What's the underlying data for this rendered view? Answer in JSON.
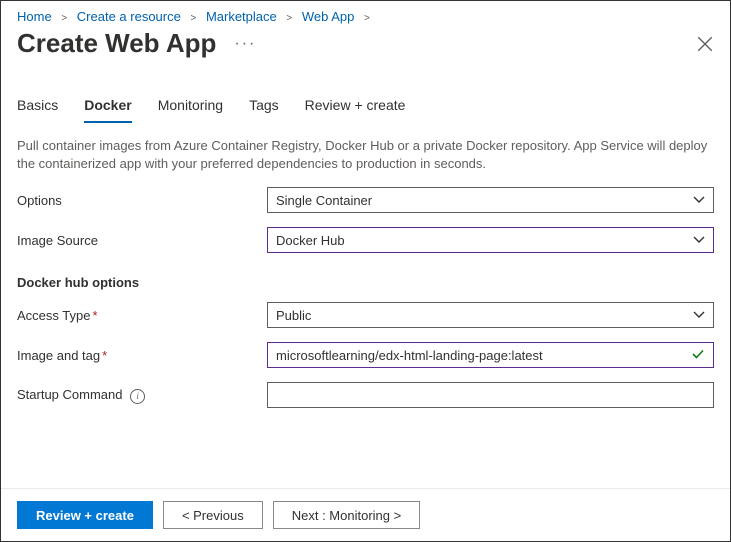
{
  "breadcrumbs": [
    {
      "label": "Home"
    },
    {
      "label": "Create a resource"
    },
    {
      "label": "Marketplace"
    },
    {
      "label": "Web App"
    }
  ],
  "title": "Create Web App",
  "tabs": [
    {
      "label": "Basics",
      "active": false
    },
    {
      "label": "Docker",
      "active": true
    },
    {
      "label": "Monitoring",
      "active": false
    },
    {
      "label": "Tags",
      "active": false
    },
    {
      "label": "Review + create",
      "active": false
    }
  ],
  "description": "Pull container images from Azure Container Registry, Docker Hub or a private Docker repository. App Service will deploy the containerized app with your preferred dependencies to production in seconds.",
  "labels": {
    "options": "Options",
    "image_source": "Image Source",
    "docker_hub_options": "Docker hub options",
    "access_type": "Access Type",
    "image_and_tag": "Image and tag",
    "startup_command": "Startup Command"
  },
  "values": {
    "options": "Single Container",
    "image_source": "Docker Hub",
    "access_type": "Public",
    "image_and_tag": "microsoftlearning/edx-html-landing-page:latest",
    "startup_command": ""
  },
  "footer": {
    "review_create": "Review + create",
    "previous": "< Previous",
    "next": "Next : Monitoring >"
  }
}
